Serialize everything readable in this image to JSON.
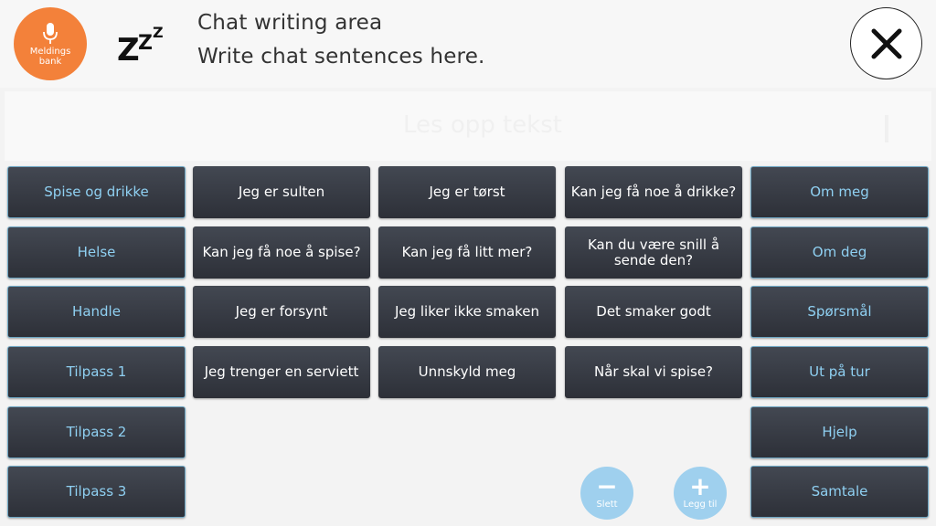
{
  "header": {
    "bank_label": "Meldings bank",
    "bank_icon": "microphone-icon",
    "sleep_icon": "zzz-icon",
    "writing_title": "Chat writing area",
    "writing_subtitle": "Write chat sentences here.",
    "close_icon": "close-icon"
  },
  "input": {
    "ghost_text": "Les opp tekst"
  },
  "left_categories": [
    "Spise og drikke",
    "Helse",
    "Handle",
    "Tilpass 1",
    "Tilpass 2",
    "Tilpass 3"
  ],
  "right_categories": [
    "Om meg",
    "Om deg",
    "Spørsmål",
    "Ut på tur",
    "Hjelp",
    "Samtale"
  ],
  "phrases": [
    [
      "Jeg er sulten",
      "Jeg er tørst",
      "Kan jeg få noe å drikke?"
    ],
    [
      "Kan jeg få noe å spise?",
      "Kan jeg få litt mer?",
      "Kan du være snill å sende den?"
    ],
    [
      "Jeg er forsynt",
      "Jeg liker ikke smaken",
      "Det smaker godt"
    ],
    [
      "Jeg trenger en serviett",
      "Unnskyld meg",
      "Når skal vi spise?"
    ]
  ],
  "actions": {
    "delete_label": "Slett",
    "add_label": "Legg til"
  },
  "colors": {
    "bank_orange": "#f3813a",
    "tile_dark": "#363a43",
    "category_text": "#8fd0f2",
    "action_blue": "#9fd0ee"
  }
}
